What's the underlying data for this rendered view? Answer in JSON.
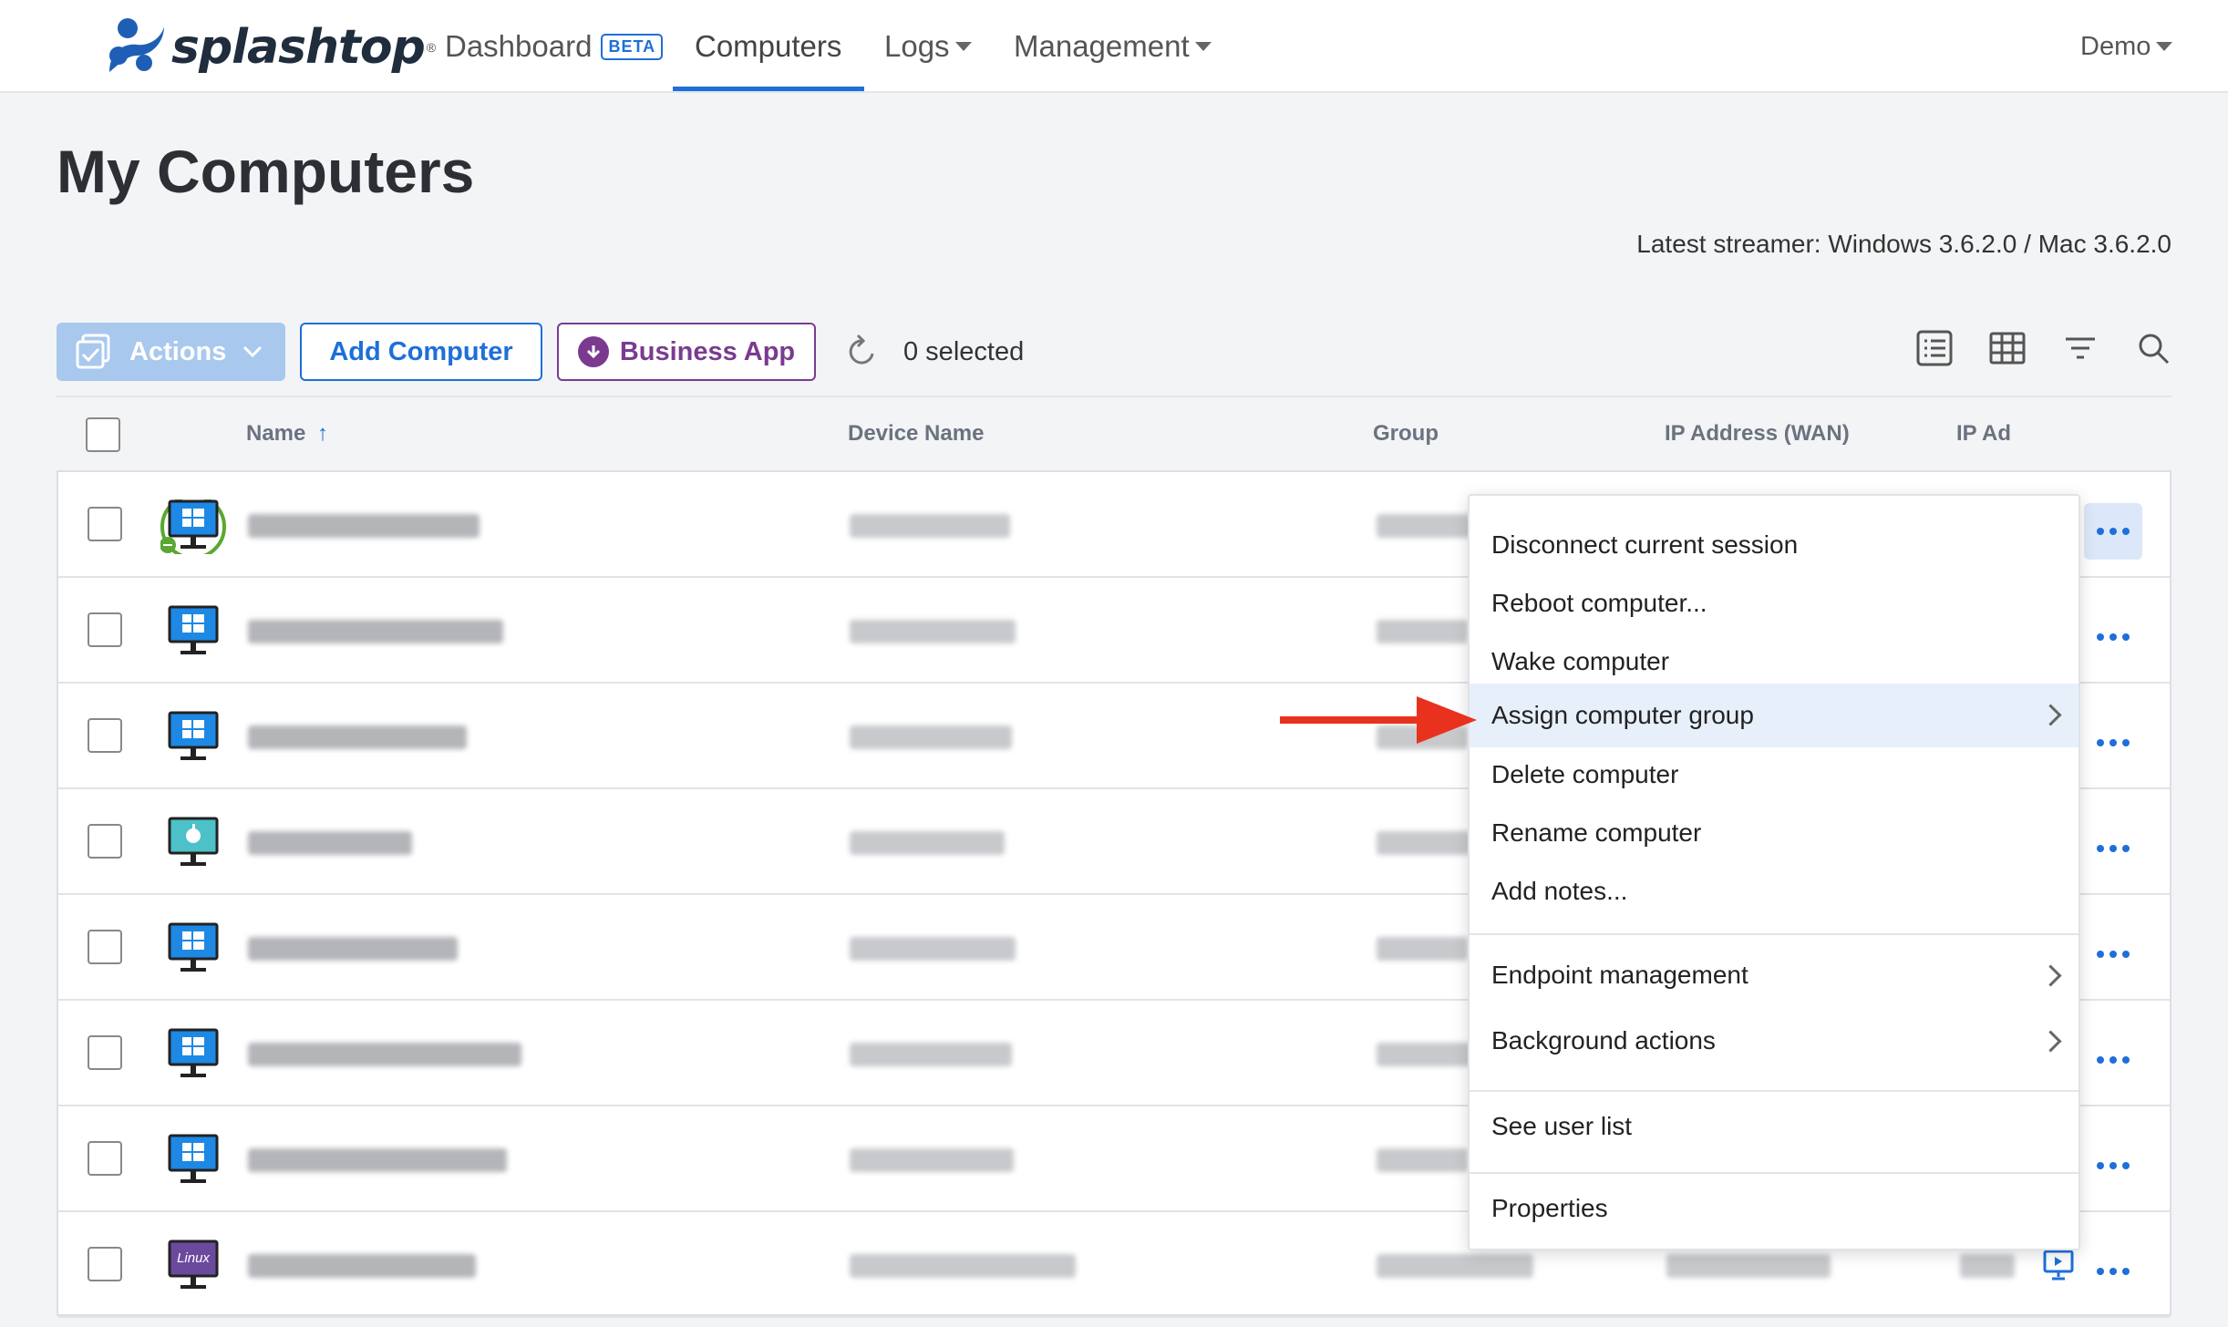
{
  "brand": {
    "name": "splashtop",
    "reg": "®"
  },
  "nav": {
    "dashboard": "Dashboard",
    "beta": "BETA",
    "computers": "Computers",
    "logs": "Logs",
    "management": "Management",
    "user": "Demo"
  },
  "page": {
    "title": "My Computers",
    "streamer": "Latest streamer: Windows 3.6.2.0 / Mac 3.6.2.0"
  },
  "toolbar": {
    "actions": "Actions",
    "add_computer": "Add Computer",
    "business_app": "Business App",
    "selected": "0 selected"
  },
  "columns": {
    "name": "Name",
    "sort_indicator": "↑",
    "device": "Device Name",
    "group": "Group",
    "ip_wan": "IP Address (WAN)",
    "ip_lan": "IP Ad"
  },
  "rows": [
    {
      "os": "windows",
      "connected": true
    },
    {
      "os": "windows",
      "connected": false
    },
    {
      "os": "windows",
      "connected": false
    },
    {
      "os": "mac",
      "connected": false
    },
    {
      "os": "windows",
      "connected": false
    },
    {
      "os": "windows",
      "connected": false
    },
    {
      "os": "windows",
      "connected": false
    },
    {
      "os": "linux",
      "connected": false,
      "linux_label": "Linux"
    }
  ],
  "context_menu": {
    "items": [
      "Disconnect current session",
      "Reboot computer...",
      "Wake computer",
      "Assign computer group",
      "Delete computer",
      "Rename computer",
      "Add notes...",
      "Endpoint management",
      "Background actions",
      "See user list",
      "Properties"
    ],
    "highlighted": "Assign computer group"
  },
  "colors": {
    "accent": "#1e6fd9",
    "business": "#7a3b8f",
    "arrow": "#e8321e",
    "connected": "#5aa832"
  }
}
